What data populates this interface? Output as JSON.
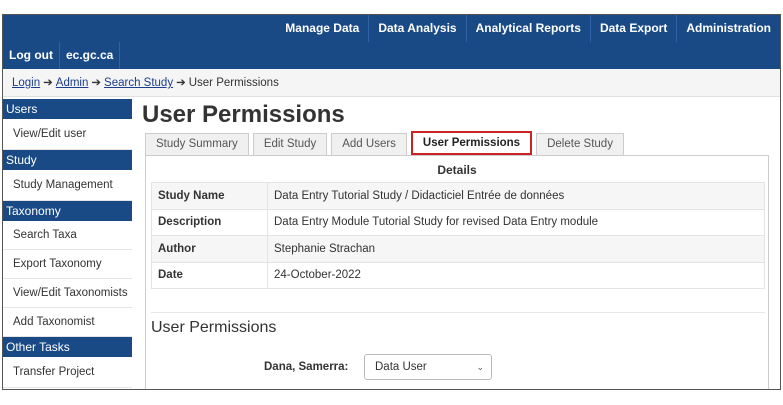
{
  "topnav": [
    "Manage Data",
    "Data Analysis",
    "Analytical Reports",
    "Data Export",
    "Administration"
  ],
  "toplinks": [
    "Log out",
    "ec.gc.ca"
  ],
  "breadcrumb": {
    "items": [
      "Login",
      "Admin",
      "Search Study"
    ],
    "current": "User Permissions",
    "separator": "➔"
  },
  "sidebar": {
    "users_head": "Users",
    "users_items": [
      "View/Edit user"
    ],
    "study_head": "Study",
    "study_items": [
      "Study Management"
    ],
    "taxonomy_head": "Taxonomy",
    "taxonomy_items": [
      "Search Taxa",
      "Export Taxonomy",
      "View/Edit Taxonomists",
      "Add Taxonomist"
    ],
    "other_head": "Other Tasks",
    "other_items": [
      "Transfer Project"
    ]
  },
  "page_title": "User Permissions",
  "tabs": [
    "Study Summary",
    "Edit Study",
    "Add Users",
    "User Permissions",
    "Delete Study"
  ],
  "active_tab": "User Permissions",
  "details": {
    "title": "Details",
    "rows": [
      {
        "key": "Study Name",
        "value": "Data Entry Tutorial Study / Didacticiel Entrée de données"
      },
      {
        "key": "Description",
        "value": "Data Entry Module Tutorial Study for revised Data Entry module"
      },
      {
        "key": "Author",
        "value": "Stephanie Strachan"
      },
      {
        "key": "Date",
        "value": "24-October-2022"
      }
    ]
  },
  "permissions": {
    "title": "User Permissions",
    "user_label": "Dana, Samerra:",
    "role_value": "Data User"
  },
  "colors": {
    "nav_blue": "#1a4a86",
    "active_tab_border": "#cc2222",
    "link": "#1a3e8c"
  }
}
